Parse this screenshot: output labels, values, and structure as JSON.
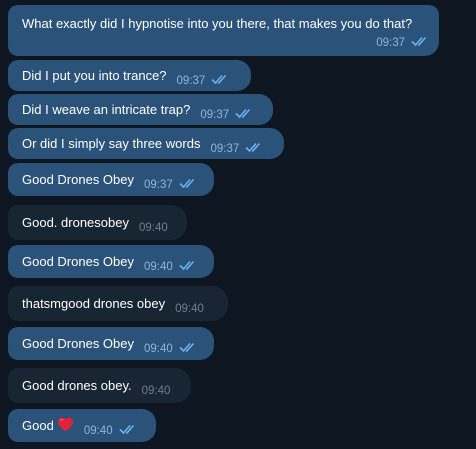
{
  "colors": {
    "background": "#0e1621",
    "outgoing_bubble": "#2b5278",
    "incoming_bubble": "#182533",
    "read_ticks": "#6ab3f3"
  },
  "messages": [
    {
      "id": "m1",
      "direction": "outgoing",
      "text": "What exactly did I hypnotise into you there, that makes you do that?",
      "time": "09:37",
      "status": "read"
    },
    {
      "id": "m2",
      "direction": "outgoing",
      "text": "Did I put you into trance?",
      "time": "09:37",
      "status": "read"
    },
    {
      "id": "m3",
      "direction": "outgoing",
      "text": "Did I weave an intricate trap?",
      "time": "09:37",
      "status": "read"
    },
    {
      "id": "m4",
      "direction": "outgoing",
      "text": "Or did I simply say three words",
      "time": "09:37",
      "status": "read"
    },
    {
      "id": "m5",
      "direction": "outgoing",
      "text": "Good Drones Obey",
      "time": "09:37",
      "status": "read"
    },
    {
      "id": "m6",
      "direction": "incoming",
      "text": "Good. dronesobey",
      "time": "09:40"
    },
    {
      "id": "m7",
      "direction": "outgoing",
      "text": "Good Drones Obey",
      "time": "09:40",
      "status": "read"
    },
    {
      "id": "m8",
      "direction": "incoming",
      "text": "thatsmgood drones obey",
      "time": "09:40"
    },
    {
      "id": "m9",
      "direction": "outgoing",
      "text": "Good Drones Obey",
      "time": "09:40",
      "status": "read"
    },
    {
      "id": "m10",
      "direction": "incoming",
      "text": "Good drones obey.",
      "time": "09:40"
    },
    {
      "id": "m11",
      "direction": "outgoing",
      "text": "Good",
      "emoji": "red-heart",
      "time": "09:40",
      "status": "read"
    }
  ]
}
